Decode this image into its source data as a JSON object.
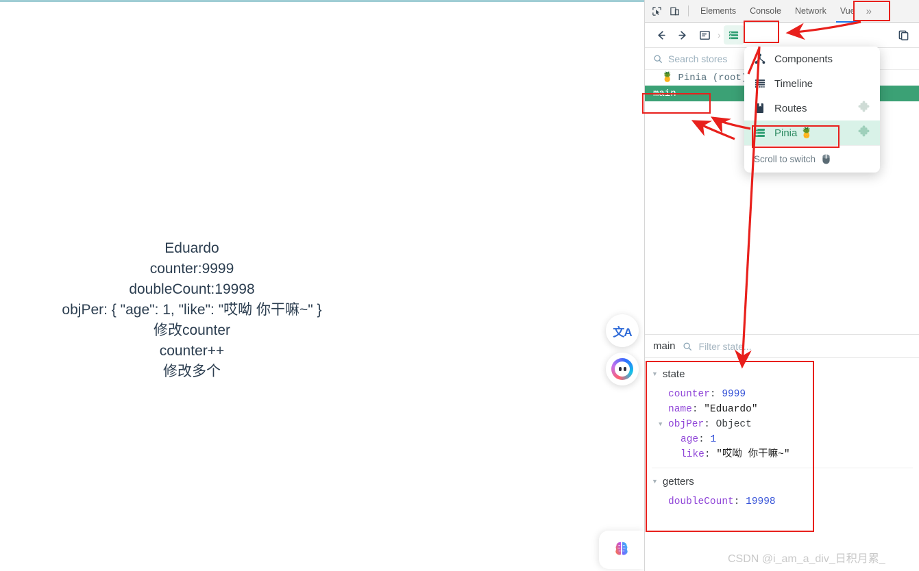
{
  "page": {
    "lines": [
      "Eduardo",
      "counter:9999",
      "doubleCount:19998",
      "objPer:  { \"age\": 1, \"like\": \"哎呦 你干嘛~\" }",
      "修改counter",
      "counter++",
      "修改多个"
    ],
    "float_buttons": [
      {
        "name": "translate-icon",
        "glyph": "文A"
      },
      {
        "name": "ai-orb-icon",
        "glyph": ""
      }
    ],
    "assistant": {
      "name": "brain-icon"
    }
  },
  "devtools": {
    "tabs": [
      {
        "label": "Elements",
        "active": false
      },
      {
        "label": "Console",
        "active": false
      },
      {
        "label": "Network",
        "active": false
      },
      {
        "label": "Vue",
        "active": true
      }
    ],
    "overflow_label": "»",
    "left_icons": [
      {
        "name": "inspect-element-icon"
      },
      {
        "name": "device-toolbar-icon"
      }
    ],
    "right_icon": {
      "name": "duplicate-panel-icon"
    },
    "accent_blue": "#1a73e8"
  },
  "vue_toolbar": {
    "back": {
      "name": "back-arrow-icon",
      "glyph": "←"
    },
    "forward": {
      "name": "forward-arrow-icon",
      "glyph": "→"
    },
    "home": {
      "name": "app-panel-icon"
    },
    "separator": "›",
    "stores": {
      "name": "stores-list-icon",
      "selected": true
    }
  },
  "stores": {
    "search_placeholder": "Search stores",
    "search_icon": "search-icon",
    "items": [
      {
        "label": "Pinia (root)",
        "icon": "pinia-logo-icon",
        "selected": false
      },
      {
        "label": "main",
        "icon": "",
        "selected": true
      }
    ],
    "selected_color": "#3ba175"
  },
  "switch_menu": {
    "items": [
      {
        "label": "Components",
        "icon": "components-tree-icon",
        "active": false,
        "plugin": false
      },
      {
        "label": "Timeline",
        "icon": "timeline-icon",
        "active": false,
        "plugin": false
      },
      {
        "label": "Routes",
        "icon": "routes-book-icon",
        "active": false,
        "plugin": true
      },
      {
        "label": "Pinia 🍍",
        "icon": "pinia-list-icon",
        "active": true,
        "plugin": true
      }
    ],
    "footer_label": "Scroll to switch",
    "footer_icon": "mouse-icon",
    "highlight_color": "#d9f2e8"
  },
  "inspector": {
    "store_name": "main",
    "filter_placeholder": "Filter state...",
    "filter_icon": "search-icon",
    "sections": [
      {
        "title": "state",
        "entries": [
          {
            "key": "counter",
            "value": "9999",
            "type": "number",
            "indent": 1
          },
          {
            "key": "name",
            "value": "\"Eduardo\"",
            "type": "string",
            "indent": 1
          },
          {
            "key": "objPer",
            "value": "Object",
            "type": "object",
            "indent": 1,
            "expandable": true
          },
          {
            "key": "age",
            "value": "1",
            "type": "number",
            "indent": 2
          },
          {
            "key": "like",
            "value": "\"哎呦 你干嘛~\"",
            "type": "string",
            "indent": 2
          }
        ]
      },
      {
        "title": "getters",
        "entries": [
          {
            "key": "doubleCount",
            "value": "19998",
            "type": "number",
            "indent": 1
          }
        ]
      }
    ]
  },
  "annotation": {
    "color": "#e8201c"
  },
  "watermark": {
    "text": "CSDN @i_am_a_div_日积月累_"
  }
}
